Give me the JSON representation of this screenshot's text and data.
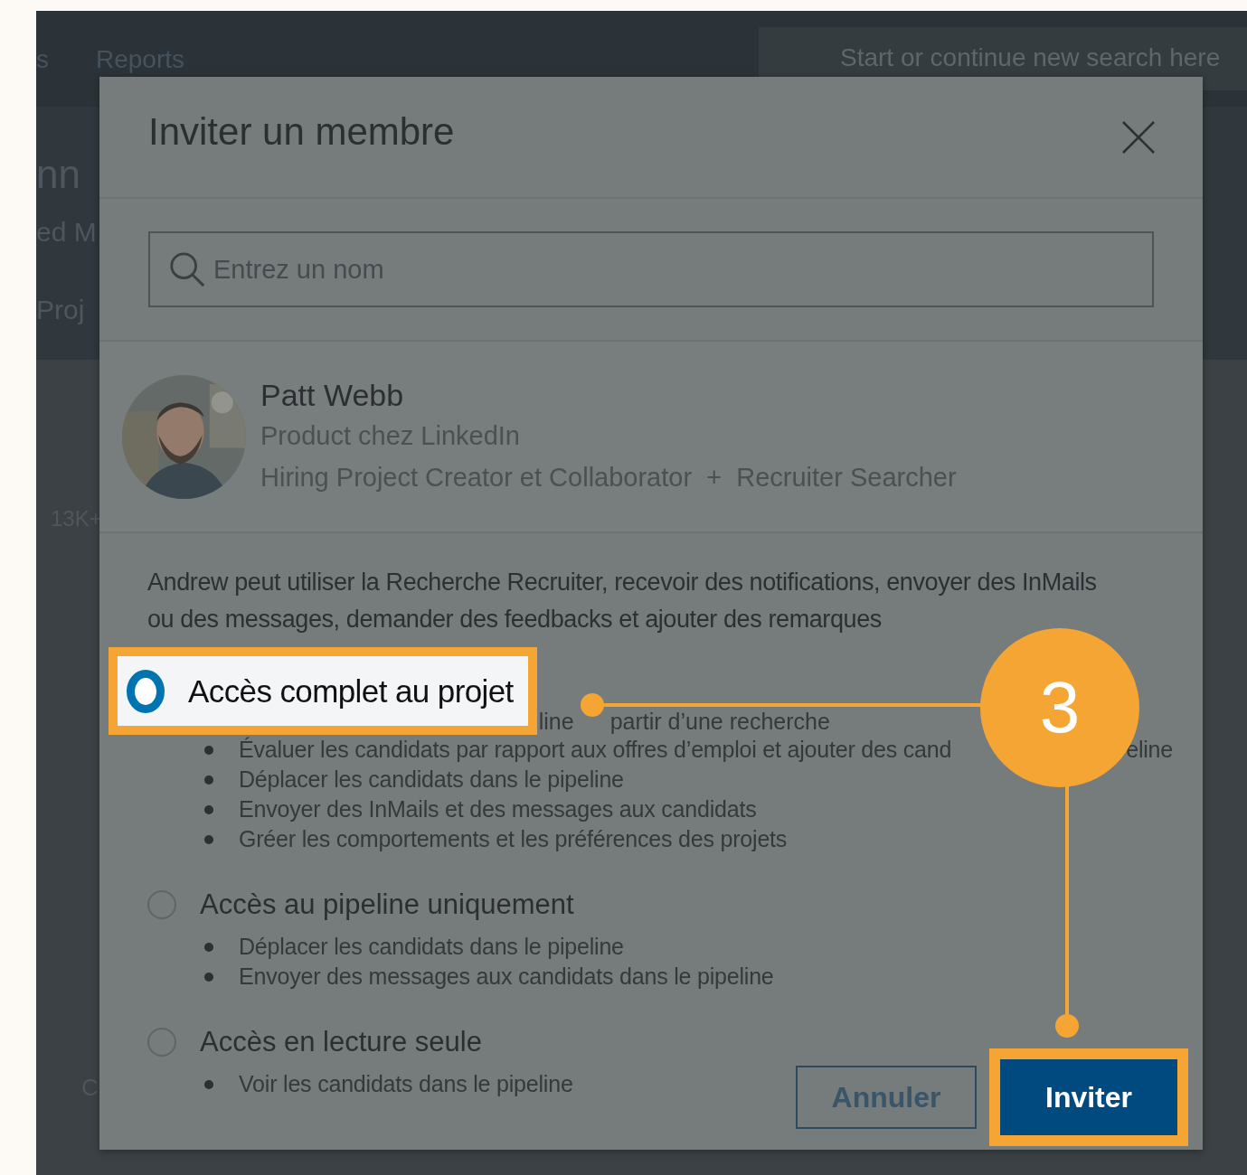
{
  "background_page": {
    "nav_items": [
      "s",
      "Reports"
    ],
    "search": {
      "placeholder": "Start or continue new search here"
    },
    "header_fragments": [
      "nn",
      "ed M",
      "Proj"
    ],
    "list_fragments": [
      "13K+",
      "C"
    ]
  },
  "dialog": {
    "title": "Inviter un membre",
    "search": {
      "placeholder": "Entrez un nom"
    },
    "member": {
      "name": "Patt Webb",
      "headline": "Product chez LinkedIn",
      "roles": "Hiring Project Creator et Collaborator  +  Recruiter Searcher"
    },
    "description": "Andrew peut utiliser la Recherche Recruiter, recevoir des notifications, envoyer des InMails ou des messages, demander des feedbacks et ajouter des remarques",
    "options": [
      {
        "label": "Accès complet au projet",
        "selected": true,
        "permissions": [
          {
            "parts": [
              "line",
              "partir d’une recherche"
            ]
          },
          {
            "parts": [
              "Évaluer les candidats par rapport aux offres d’emploi et ajouter des cand",
              "eline"
            ]
          },
          {
            "parts": [
              "Déplacer les candidats dans le pipeline"
            ]
          },
          {
            "parts": [
              "Envoyer des InMails et des messages aux candidats"
            ]
          },
          {
            "parts": [
              "Gréer les comportements et les préférences des projets"
            ]
          }
        ]
      },
      {
        "label": "Accès au pipeline uniquement",
        "selected": false,
        "permissions": [
          {
            "parts": [
              "Déplacer les candidats dans le pipeline"
            ]
          },
          {
            "parts": [
              "Envoyer des messages aux candidats dans le pipeline"
            ]
          }
        ]
      },
      {
        "label": "Accès en lecture seule",
        "selected": false,
        "permissions": [
          {
            "parts": [
              "Voir les candidats dans le pipeline"
            ]
          }
        ]
      }
    ],
    "buttons": [
      {
        "label": "Annuler",
        "kind": "secondary",
        "highlighted": false
      },
      {
        "label": "Inviter",
        "kind": "primary",
        "highlighted": true
      }
    ]
  },
  "callout": {
    "number": "3"
  }
}
